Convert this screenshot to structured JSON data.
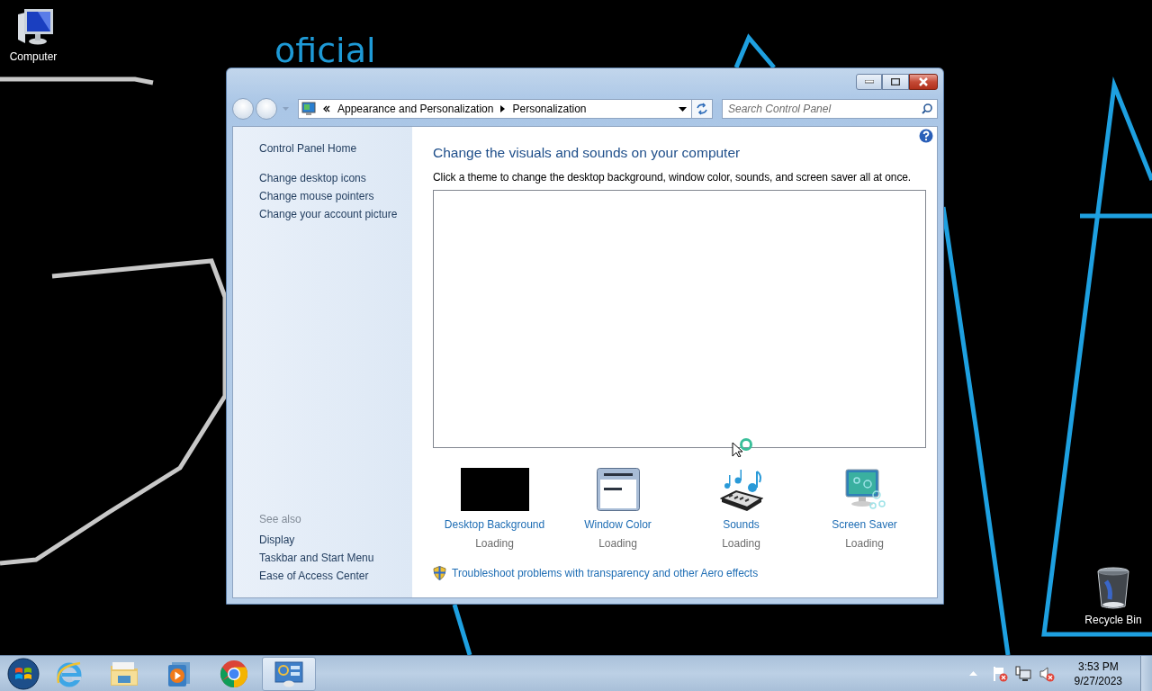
{
  "desktop": {
    "wallpaper_text": "oficial",
    "icons": [
      {
        "kind": "computer",
        "label": "Computer"
      },
      {
        "kind": "recycle",
        "label": "Recycle Bin"
      }
    ]
  },
  "window": {
    "address": {
      "crumbs": [
        "Appearance and Personalization",
        "Personalization"
      ]
    },
    "search": {
      "placeholder": "Search Control Panel"
    },
    "sidebar": {
      "links": [
        "Control Panel Home",
        "Change desktop icons",
        "Change mouse pointers",
        "Change your account picture"
      ],
      "see_also_heading": "See also",
      "see_also": [
        "Display",
        "Taskbar and Start Menu",
        "Ease of Access Center"
      ]
    },
    "main": {
      "heading": "Change the visuals and sounds on your computer",
      "description": "Click a theme to change the desktop background, window color, sounds, and screen saver all at once.",
      "settings": [
        {
          "kind": "background",
          "label": "Desktop Background",
          "status": "Loading"
        },
        {
          "kind": "color",
          "label": "Window Color",
          "status": "Loading"
        },
        {
          "kind": "sounds",
          "label": "Sounds",
          "status": "Loading"
        },
        {
          "kind": "screensaver",
          "label": "Screen Saver",
          "status": "Loading"
        }
      ],
      "troubleshoot_link": "Troubleshoot problems with transparency and other Aero effects"
    }
  },
  "taskbar": {
    "pinned": [
      {
        "kind": "ie",
        "selected": false
      },
      {
        "kind": "explorer",
        "selected": false
      },
      {
        "kind": "media",
        "selected": false
      },
      {
        "kind": "chrome",
        "selected": false
      },
      {
        "kind": "control-panel",
        "selected": true
      }
    ],
    "clock": {
      "time": "3:53 PM",
      "date": "9/27/2023"
    }
  }
}
